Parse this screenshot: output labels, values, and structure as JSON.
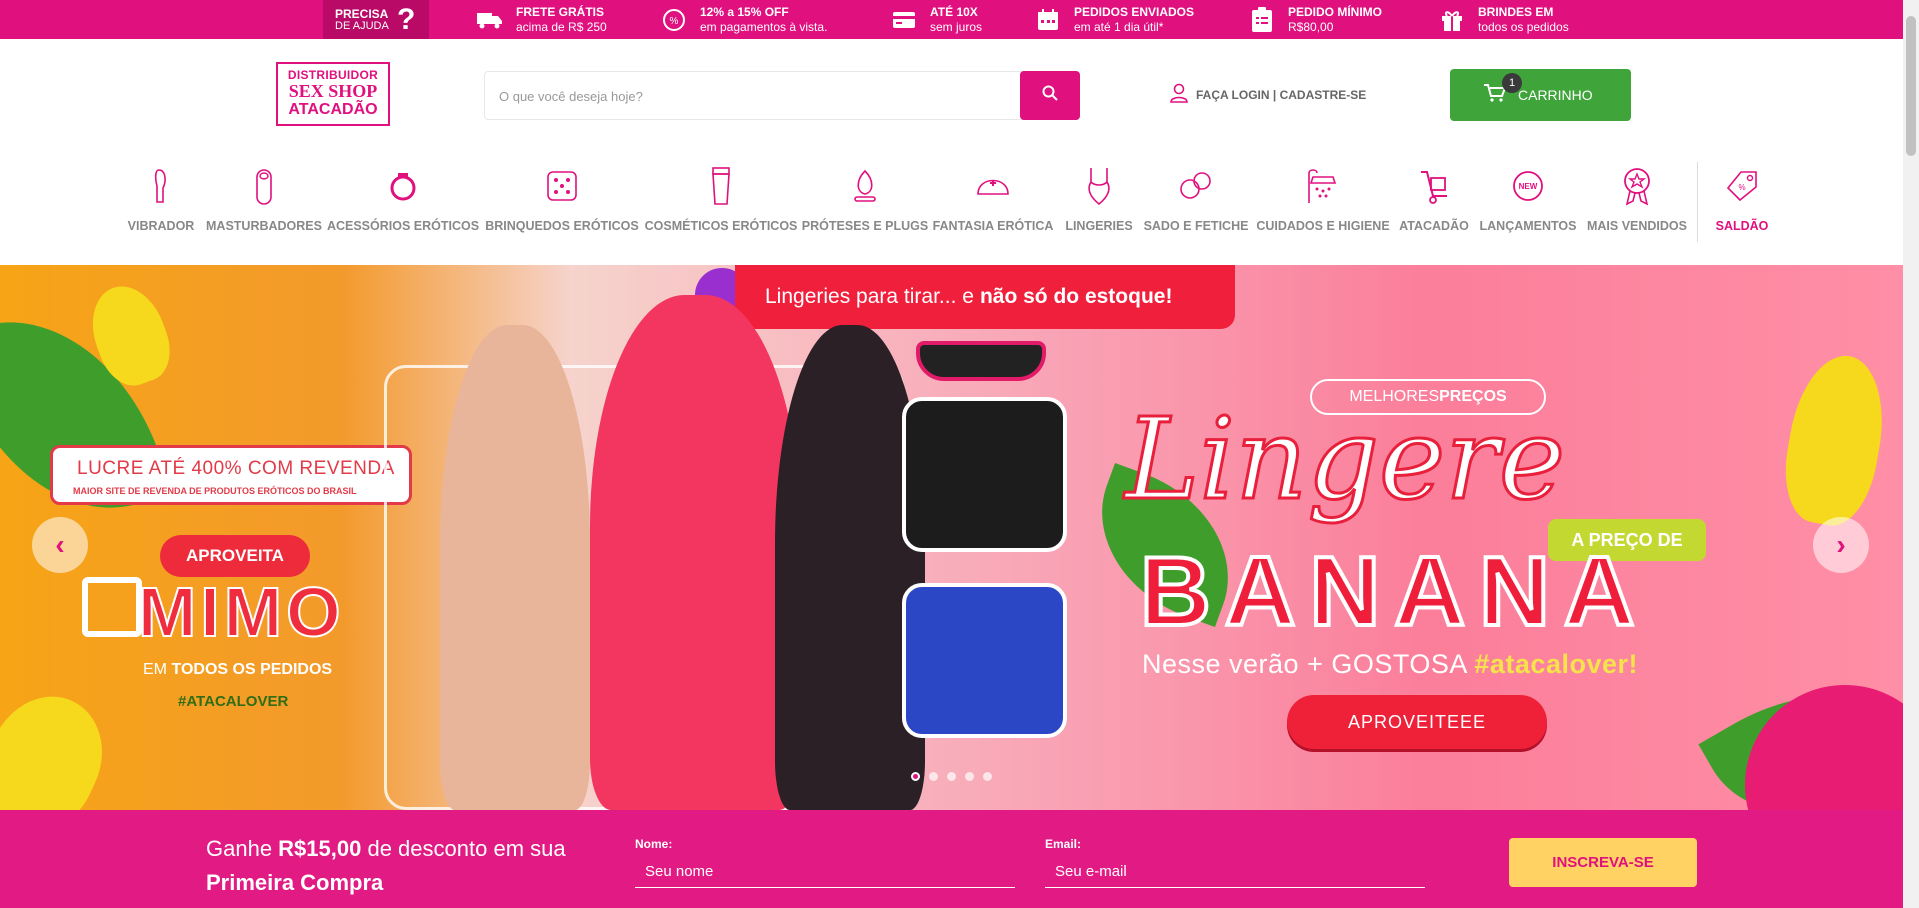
{
  "topbar": {
    "help": {
      "line1": "PRECISA",
      "line2": "DE AJUDA",
      "mark": "?"
    },
    "perks": [
      {
        "icon": "truck-icon",
        "title": "FRETE GRÁTIS",
        "subtitle": "acima de R$ 250"
      },
      {
        "icon": "discount-icon",
        "title": "12% a 15% OFF",
        "subtitle": "em pagamentos à vista."
      },
      {
        "icon": "card-icon",
        "title": "ATÉ 10X",
        "subtitle": "sem juros"
      },
      {
        "icon": "calendar-icon",
        "title": "PEDIDOS ENVIADOS",
        "subtitle": "em até 1 dia útil*"
      },
      {
        "icon": "clipboard-icon",
        "title": "PEDIDO MÍNIMO",
        "subtitle": "R$80,00"
      },
      {
        "icon": "gift-icon",
        "title": "BRINDES EM",
        "subtitle": "todos os pedidos"
      }
    ]
  },
  "header": {
    "logo": {
      "line1": "DISTRIBUIDOR",
      "line2": "SEX SHOP",
      "line3": "ATACADÃO"
    },
    "search": {
      "placeholder": "O que você deseja hoje?"
    },
    "login": "FAÇA LOGIN | CADASTRE-SE",
    "cart": {
      "label": "CARRINHO",
      "count": "1"
    }
  },
  "categories": [
    {
      "label": "VIBRADOR",
      "icon": "vibrator-icon"
    },
    {
      "label": "MASTURBADORES",
      "icon": "masturbator-icon"
    },
    {
      "label": "ACESSÓRIOS ERÓTICOS",
      "icon": "ring-icon"
    },
    {
      "label": "BRINQUEDOS ERÓTICOS",
      "icon": "dice-icon"
    },
    {
      "label": "COSMÉTICOS ERÓTICOS",
      "icon": "tube-icon"
    },
    {
      "label": "PRÓTESES E PLUGS",
      "icon": "plug-icon"
    },
    {
      "label": "FANTASIA ERÓTICA",
      "icon": "nurse-cap-icon"
    },
    {
      "label": "LINGERIES",
      "icon": "lingerie-icon"
    },
    {
      "label": "SADO E FETICHE",
      "icon": "handcuffs-icon"
    },
    {
      "label": "CUIDADOS E HIGIENE",
      "icon": "shower-icon"
    },
    {
      "label": "ATACADÃO",
      "icon": "hand-truck-icon"
    },
    {
      "label": "LANÇAMENTOS",
      "icon": "new-badge-icon"
    },
    {
      "label": "MAIS VENDIDOS",
      "icon": "medal-icon"
    },
    {
      "label": "SALDÃO",
      "icon": "tag-icon"
    }
  ],
  "banner": {
    "top_text_a": "Lingeries para tirar... e ",
    "top_text_b": "não só do estoque!",
    "lucre_title": "LUCRE ATÉ 400% COM REVENDA",
    "lucre_sub": "MAIOR SITE DE REVENDA DE PRODUTOS ERÓTICOS DO BRASIL",
    "aproveita": "APROVEITA",
    "mimo": "MIMO",
    "mimo_sub_a": "EM ",
    "mimo_sub_b": "TODOS OS PEDIDOS",
    "mimo_tag": "#ATACALOVER",
    "melhores_a": "MELHORES ",
    "melhores_b": "PREÇOS",
    "script_title": "Lingere",
    "preco_badge": "A PREÇO DE",
    "big_word": "BANANA",
    "verao_a": "Nesse verão + GOSTOSA ",
    "verao_b": "#atacalover!",
    "cta": "APROVEITEEE",
    "slides": 5,
    "active_slide": 1
  },
  "newsletter": {
    "title_a": "Ganhe ",
    "title_b": "R$15,00",
    "title_c": " de desconto em sua ",
    "title_d": "Primeira Compra",
    "name_label": "Nome:",
    "name_placeholder": "Seu nome",
    "email_label": "Email:",
    "email_placeholder": "Seu e-mail",
    "submit": "INSCREVA-SE"
  },
  "colors": {
    "brand": "#e0107f",
    "cart": "#3fa43a",
    "subscribe": "#ffd263"
  }
}
